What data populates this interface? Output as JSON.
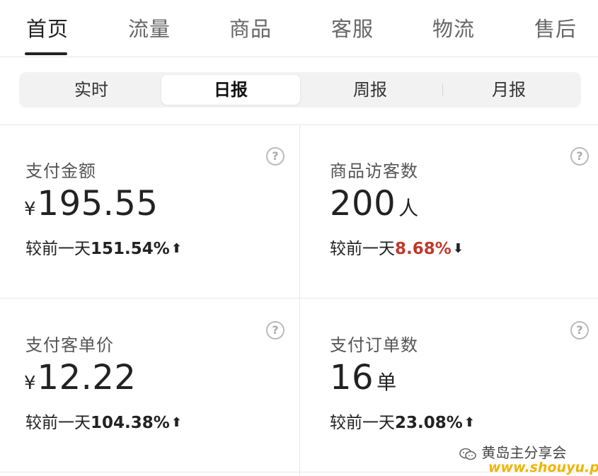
{
  "tabs": [
    {
      "label": "首页",
      "active": true
    },
    {
      "label": "流量",
      "active": false
    },
    {
      "label": "商品",
      "active": false
    },
    {
      "label": "客服",
      "active": false
    },
    {
      "label": "物流",
      "active": false
    },
    {
      "label": "售后",
      "active": false
    }
  ],
  "segments": [
    {
      "label": "实时",
      "active": false
    },
    {
      "label": "日报",
      "active": true
    },
    {
      "label": "周报",
      "active": false
    },
    {
      "label": "月报",
      "active": false
    }
  ],
  "metrics": [
    {
      "label": "支付金额",
      "currency": "¥",
      "value": "195.55",
      "unit": "",
      "compare_label": "较前一天",
      "change": "151.54%",
      "direction": "up",
      "arrow": "⬆"
    },
    {
      "label": "商品访客数",
      "currency": "",
      "value": "200",
      "unit": "人",
      "compare_label": "较前一天",
      "change": "8.68%",
      "direction": "down",
      "arrow": "⬇"
    },
    {
      "label": "支付客单价",
      "currency": "¥",
      "value": "12.22",
      "unit": "",
      "compare_label": "较前一天",
      "change": "104.38%",
      "direction": "up",
      "arrow": "⬆"
    },
    {
      "label": "支付订单数",
      "currency": "",
      "value": "16",
      "unit": "单",
      "compare_label": "较前一天",
      "change": "23.08%",
      "direction": "up",
      "arrow": "⬆"
    }
  ],
  "help_symbol": "?",
  "colors": {
    "down": "#c0392b",
    "active_text": "#222222",
    "inactive_text": "#666666"
  },
  "watermark": {
    "text": "黄岛主分享会",
    "url": "www.shouyu.pw",
    "icon": "wechat-icon"
  }
}
